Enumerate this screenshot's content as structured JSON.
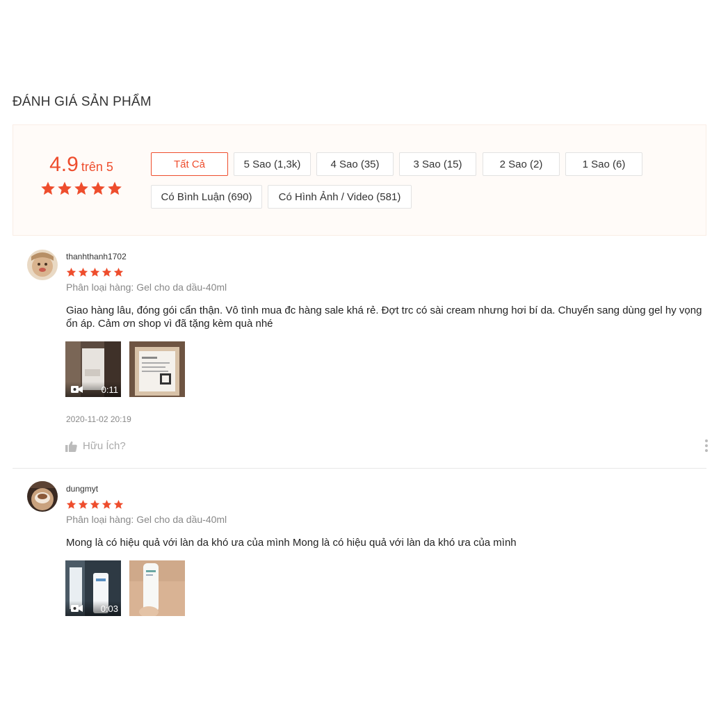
{
  "header": {
    "title": "ĐÁNH GIÁ SẢN PHẨM"
  },
  "summary": {
    "score": "4.9",
    "score_suffix": "trên 5",
    "rating_stars": 5,
    "filters": [
      "Tất Cả",
      "5 Sao (1,3k)",
      "4 Sao (35)",
      "3 Sao (15)",
      "2 Sao (2)",
      "1 Sao (6)",
      "Có Bình Luận (690)",
      "Có Hình Ảnh / Video (581)"
    ],
    "active_filter": "Tất Cả"
  },
  "reviews": [
    {
      "username": "thanhthanh1702",
      "stars": 5,
      "variant": "Phân loại hàng: Gel cho da dầu-40ml",
      "comment": "Giao hàng lâu, đóng gói cẩn thận. Vô tình mua đc hàng sale khá rẻ. Đợt trc có sài cream nhưng hơi bí da. Chuyển sang dùng gel hy vọng ổn áp. Cảm ơn shop vì đã tặng kèm quà nhé",
      "video_duration": "0:11",
      "date": "2020-11-02 20:19",
      "helpful_label": "Hữu Ích?"
    },
    {
      "username": "dungmyt",
      "stars": 5,
      "variant": "Phân loại hàng: Gel cho da dầu-40ml",
      "comment": "Mong là có hiệu quả với làn da khó ưa của mình Mong là có hiệu quả với làn da khó ưa của mình",
      "video_duration": "0:03"
    }
  ],
  "colors": {
    "accent": "#ee4d2d",
    "muted": "#888888",
    "summary_bg": "#fffbf8"
  },
  "icons": [
    "star-icon",
    "video-camera-icon",
    "thumbs-up-icon",
    "more-vertical-icon"
  ]
}
